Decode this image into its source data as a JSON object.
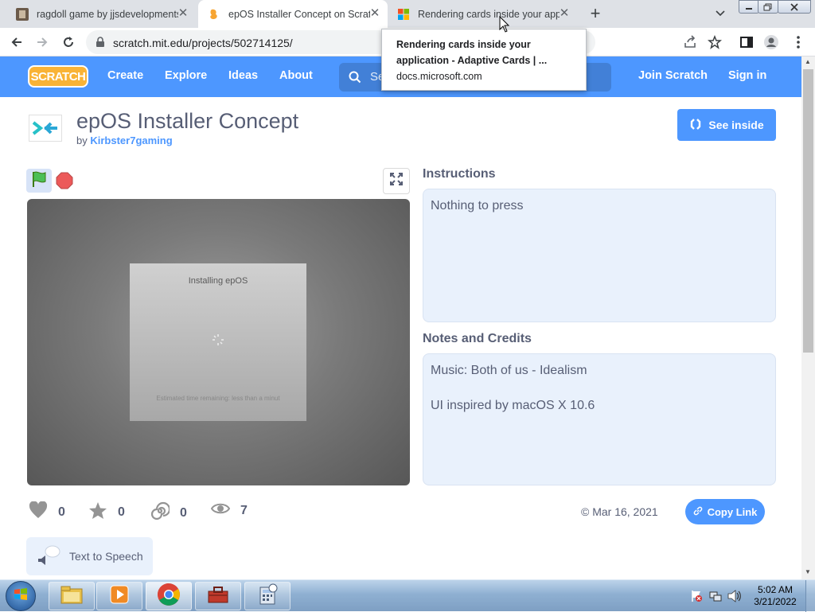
{
  "browser": {
    "tabs": [
      {
        "title": "ragdoll game by jjsdevelopments",
        "active": false
      },
      {
        "title": "epOS Installer Concept on Scratc",
        "active": true
      },
      {
        "title": "Rendering cards inside your appl",
        "active": false
      }
    ],
    "url": "scratch.mit.edu/projects/502714125/",
    "tooltip": {
      "title_line1": "Rendering cards inside your",
      "title_line2": "application - Adaptive Cards | ...",
      "domain": "docs.microsoft.com"
    }
  },
  "scratch_nav": {
    "logo": "SCRATCH",
    "links": [
      "Create",
      "Explore",
      "Ideas",
      "About"
    ],
    "search_placeholder": "Se",
    "join": "Join Scratch",
    "signin": "Sign in"
  },
  "project": {
    "title": "epOS Installer Concept",
    "by_prefix": "by",
    "author": "Kirbster7gaming",
    "see_inside": "See inside",
    "stage": {
      "dialog_title": "Installing epOS",
      "dialog_footer": "Estimated time remaining: less than a minut"
    },
    "instructions_heading": "Instructions",
    "instructions_text": "Nothing to press",
    "notes_heading": "Notes and Credits",
    "notes_line1": "Music: Both of us - Idealism",
    "notes_line2": "UI inspired by macOS X 10.6",
    "stats": {
      "loves": "0",
      "favorites": "0",
      "remixes": "0",
      "views": "7"
    },
    "date": "© Mar 16, 2021",
    "copy_link": "Copy Link",
    "tts": "Text to Speech"
  },
  "taskbar": {
    "time": "5:02 AM",
    "date": "3/21/2022"
  },
  "colors": {
    "scratch_blue": "#4d97ff",
    "text_gray": "#575e75",
    "panel_bg": "#e9f1fc"
  }
}
